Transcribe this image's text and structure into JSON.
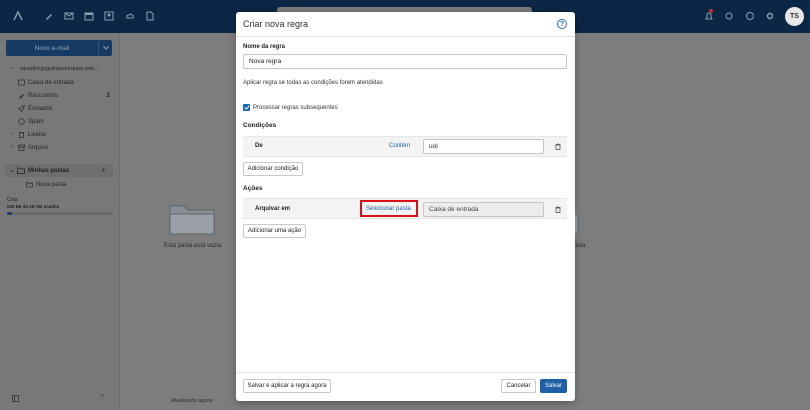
{
  "topbar": {
    "avatar_initials": "TS",
    "accent": "#0b2745"
  },
  "sidebar": {
    "new_mail_label": "Novo e-mail",
    "account": "squadtongoguimgworkspace.web...",
    "folders": [
      {
        "label": "Caixa de entrada",
        "count": ""
      },
      {
        "label": "Rascunhos",
        "count": "2"
      },
      {
        "label": "Enviados",
        "count": ""
      },
      {
        "label": "Spam",
        "count": ""
      },
      {
        "label": "Lixeira",
        "count": ""
      },
      {
        "label": "Arquivo",
        "count": ""
      }
    ],
    "my_folders_label": "Minhas pastas",
    "my_folders": [
      {
        "label": "Nova pasta"
      }
    ],
    "quota_label": "Cota",
    "quota_value": "535 kB de 25 GB usados",
    "quota_fraction": 0.05
  },
  "list": {
    "empty_text": "Esta pasta está vazia",
    "updated_text": "Atualizado agora",
    "right_fragment": "asta"
  },
  "modal": {
    "title": "Criar nova regra",
    "name_label": "Nome da regra",
    "name_value": "Nova regra",
    "apply_text": "Aplicar regra se todas as condições forem atendidas",
    "process_label": "Processar regras subsequentes",
    "process_checked": true,
    "conditions_heading": "Condições",
    "condition": {
      "field": "De",
      "operator": "Contém",
      "value": "uol"
    },
    "add_condition": "Adicionar condição",
    "actions_heading": "Ações",
    "action": {
      "label": "Arquivar em",
      "select_link": "Selecionar pasta",
      "folder_value": "Caixa de entrada"
    },
    "add_action": "Adicionar uma ação",
    "save_apply_btn": "Salvar e aplicar a regra agora",
    "cancel_btn": "Cancelar",
    "save_btn": "Salvar"
  },
  "colors": {
    "primary": "#1f5fa5",
    "link": "#2463ad",
    "highlight": "#d90f1a"
  }
}
